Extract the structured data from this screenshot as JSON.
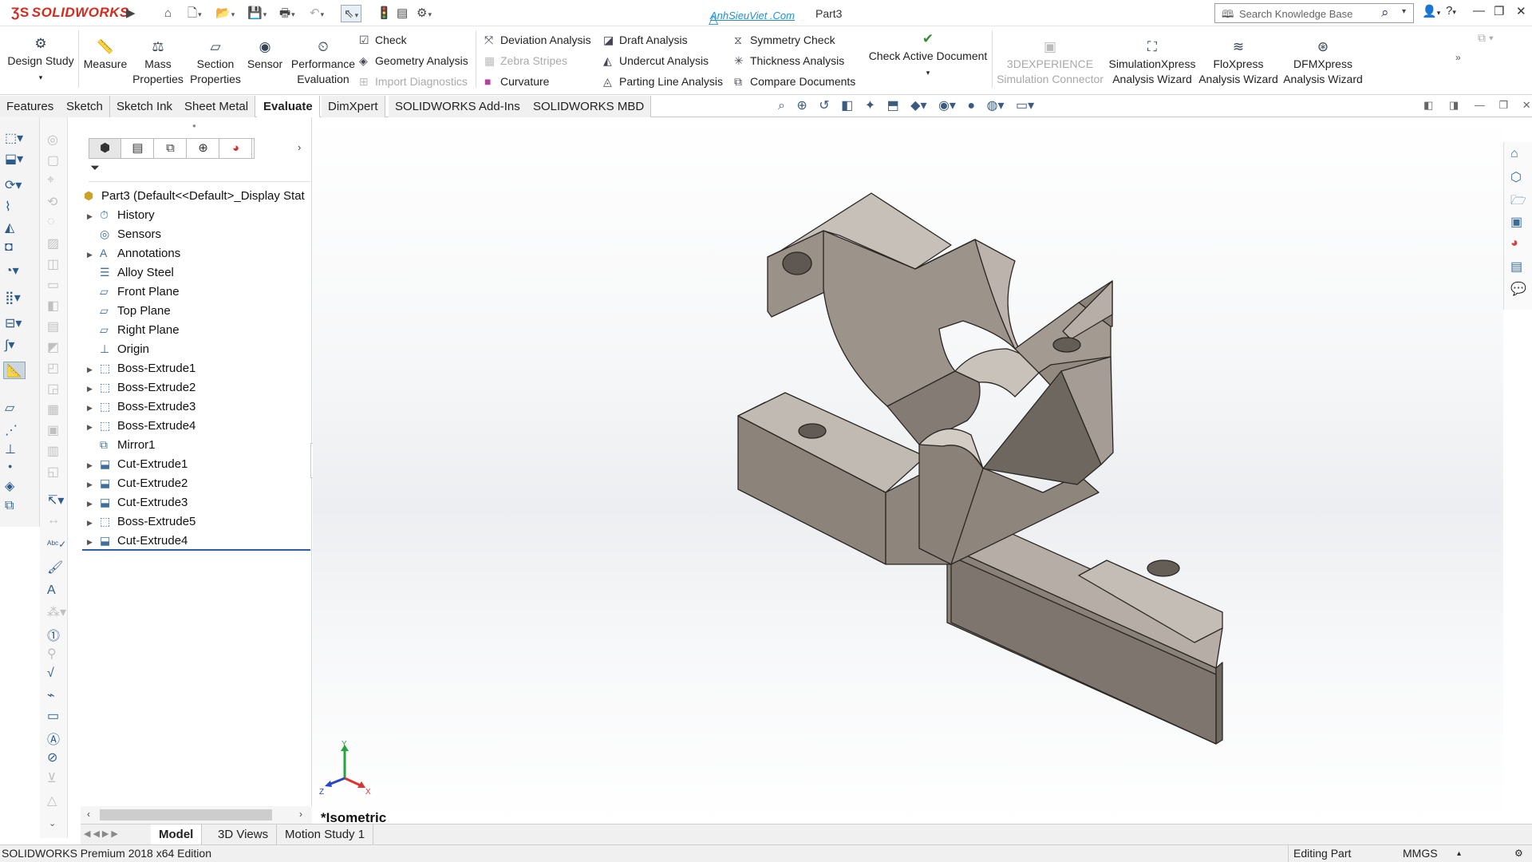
{
  "app": {
    "logo_text": "SOLIDWORKS",
    "document_title": "Part3",
    "watermark": "AnhSieuViet .Com"
  },
  "search": {
    "placeholder": "Search Knowledge Base"
  },
  "ribbon": {
    "design_study": "Design Study",
    "measure": "Measure",
    "mass_properties_1": "Mass",
    "mass_properties_2": "Properties",
    "section_properties_1": "Section",
    "section_properties_2": "Properties",
    "sensor": "Sensor",
    "performance_1": "Performance",
    "performance_2": "Evaluation",
    "check": "Check",
    "geometry_analysis": "Geometry Analysis",
    "import_diagnostics": "Import Diagnostics",
    "deviation_analysis": "Deviation Analysis",
    "zebra_stripes": "Zebra Stripes",
    "curvature": "Curvature",
    "draft_analysis": "Draft Analysis",
    "undercut_analysis": "Undercut Analysis",
    "parting_line_analysis": "Parting Line Analysis",
    "symmetry_check": "Symmetry Check",
    "thickness_analysis": "Thickness Analysis",
    "compare_documents": "Compare Documents",
    "check_active_document": "Check Active Document",
    "experience_1": "3DEXPERIENCE",
    "experience_2": "Simulation Connector",
    "simxpress_1": "SimulationXpress",
    "simxpress_2": "Analysis Wizard",
    "floxpress_1": "FloXpress",
    "floxpress_2": "Analysis Wizard",
    "dfmxpress_1": "DFMXpress",
    "dfmxpress_2": "Analysis Wizard"
  },
  "tabs": [
    "Features",
    "Sketch",
    "Sketch Ink",
    "Sheet Metal",
    "Evaluate",
    "DimXpert",
    "SOLIDWORKS Add-Ins",
    "SOLIDWORKS MBD"
  ],
  "active_tab": "Evaluate",
  "feature_tree": {
    "root": "Part3  (Default<<Default>_Display Stat",
    "items": [
      {
        "label": "History",
        "icon": "history-icon",
        "expandable": true
      },
      {
        "label": "Sensors",
        "icon": "sensors-icon",
        "expandable": false
      },
      {
        "label": "Annotations",
        "icon": "annotations-icon",
        "expandable": true
      },
      {
        "label": "Alloy Steel",
        "icon": "material-icon",
        "expandable": false
      },
      {
        "label": "Front Plane",
        "icon": "plane-icon",
        "expandable": false
      },
      {
        "label": "Top Plane",
        "icon": "plane-icon",
        "expandable": false
      },
      {
        "label": "Right Plane",
        "icon": "plane-icon",
        "expandable": false
      },
      {
        "label": "Origin",
        "icon": "origin-icon",
        "expandable": false
      },
      {
        "label": "Boss-Extrude1",
        "icon": "extrude-icon",
        "expandable": true
      },
      {
        "label": "Boss-Extrude2",
        "icon": "extrude-icon",
        "expandable": true
      },
      {
        "label": "Boss-Extrude3",
        "icon": "extrude-icon",
        "expandable": true
      },
      {
        "label": "Boss-Extrude4",
        "icon": "extrude-icon",
        "expandable": true
      },
      {
        "label": "Mirror1",
        "icon": "mirror-icon",
        "expandable": false
      },
      {
        "label": "Cut-Extrude1",
        "icon": "cut-icon",
        "expandable": true
      },
      {
        "label": "Cut-Extrude2",
        "icon": "cut-icon",
        "expandable": true
      },
      {
        "label": "Cut-Extrude3",
        "icon": "cut-icon",
        "expandable": true
      },
      {
        "label": "Boss-Extrude5",
        "icon": "extrude-icon",
        "expandable": true
      },
      {
        "label": "Cut-Extrude4",
        "icon": "cut-icon",
        "expandable": true
      }
    ]
  },
  "viewport": {
    "view_name": "*Isometric",
    "triad": {
      "x": "X",
      "y": "Y",
      "z": "Z"
    }
  },
  "bottom_tabs": [
    "Model",
    "3D Views",
    "Motion Study 1"
  ],
  "status": {
    "edition": "SOLIDWORKS Premium 2018 x64 Edition",
    "mode": "Editing Part",
    "units": "MMGS"
  },
  "colors": {
    "brand": "#d52b1e",
    "part_face": "#8e857c",
    "accent": "#1d8fd6"
  }
}
